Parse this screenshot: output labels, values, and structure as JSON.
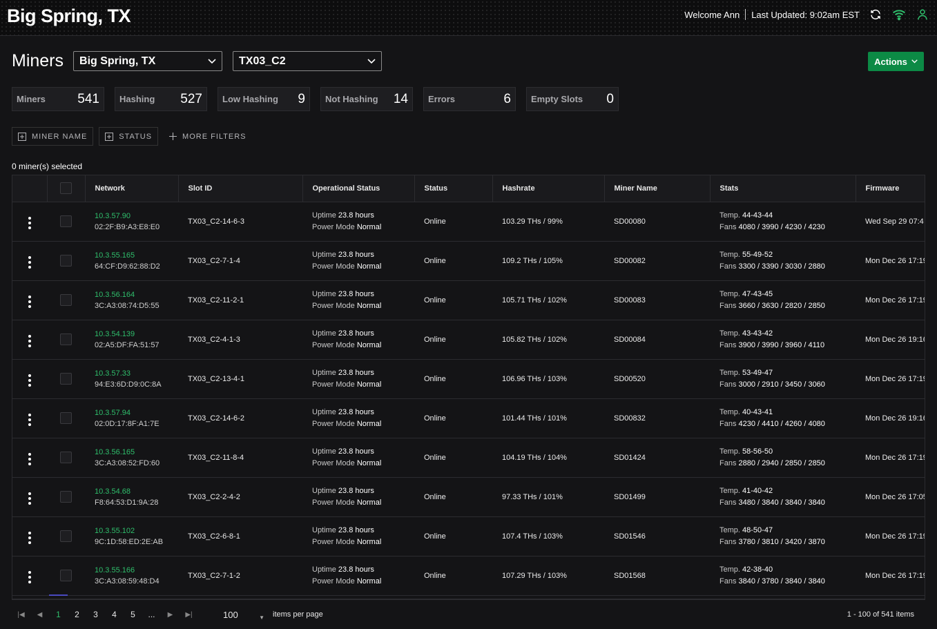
{
  "site_title": "Big Spring, TX",
  "topbar": {
    "welcome": "Welcome Ann",
    "last_updated": "Last Updated: 9:02am EST"
  },
  "page_title": "Miners",
  "site_select": "Big Spring, TX",
  "container_select": "TX03_C2",
  "actions_label": "Actions",
  "stats": [
    {
      "label": "Miners",
      "value": "541"
    },
    {
      "label": "Hashing",
      "value": "527"
    },
    {
      "label": "Low Hashing",
      "value": "9"
    },
    {
      "label": "Not Hashing",
      "value": "14"
    },
    {
      "label": "Errors",
      "value": "6"
    },
    {
      "label": "Empty Slots",
      "value": "0"
    }
  ],
  "filters": {
    "miner_name": "MINER NAME",
    "status": "STATUS",
    "more": "MORE FILTERS"
  },
  "selected_count": "0 miner(s) selected",
  "columns": [
    "Network",
    "Slot ID",
    "Operational Status",
    "Status",
    "Hashrate",
    "Miner Name",
    "Stats",
    "Firmware"
  ],
  "labels": {
    "uptime": "Uptime",
    "power_mode": "Power Mode",
    "temp": "Temp.",
    "fans": "Fans"
  },
  "rows": [
    {
      "ip": "10.3.57.90",
      "mac": "02:2F:B9:A3:E8:E0",
      "slot": "TX03_C2-14-6-3",
      "uptime": "23.8 hours",
      "power": "Normal",
      "status": "Online",
      "hashrate": "103.29 THs / 99%",
      "name": "SD00080",
      "temp": "44-43-44",
      "fans": "4080 / 3990 / 4230 / 4230",
      "firmware": "Wed Sep 29 07:4"
    },
    {
      "ip": "10.3.55.165",
      "mac": "64:CF:D9:62:88:D2",
      "slot": "TX03_C2-7-1-4",
      "uptime": "23.8 hours",
      "power": "Normal",
      "status": "Online",
      "hashrate": "109.2 THs / 105%",
      "name": "SD00082",
      "temp": "55-49-52",
      "fans": "3300 / 3390 / 3030 / 2880",
      "firmware": "Mon Dec 26 17:19"
    },
    {
      "ip": "10.3.56.164",
      "mac": "3C:A3:08:74:D5:55",
      "slot": "TX03_C2-11-2-1",
      "uptime": "23.8 hours",
      "power": "Normal",
      "status": "Online",
      "hashrate": "105.71 THs / 102%",
      "name": "SD00083",
      "temp": "47-43-45",
      "fans": "3660 / 3630 / 2820 / 2850",
      "firmware": "Mon Dec 26 17:19"
    },
    {
      "ip": "10.3.54.139",
      "mac": "02:A5:DF:FA:51:57",
      "slot": "TX03_C2-4-1-3",
      "uptime": "23.8 hours",
      "power": "Normal",
      "status": "Online",
      "hashrate": "105.82 THs / 102%",
      "name": "SD00084",
      "temp": "43-43-42",
      "fans": "3900 / 3990 / 3960 / 4110",
      "firmware": "Mon Dec 26 19:16"
    },
    {
      "ip": "10.3.57.33",
      "mac": "94:E3:6D:D9:0C:8A",
      "slot": "TX03_C2-13-4-1",
      "uptime": "23.8 hours",
      "power": "Normal",
      "status": "Online",
      "hashrate": "106.96 THs / 103%",
      "name": "SD00520",
      "temp": "53-49-47",
      "fans": "3000 / 2910 / 3450 / 3060",
      "firmware": "Mon Dec 26 17:19"
    },
    {
      "ip": "10.3.57.94",
      "mac": "02:0D:17:8F:A1:7E",
      "slot": "TX03_C2-14-6-2",
      "uptime": "23.8 hours",
      "power": "Normal",
      "status": "Online",
      "hashrate": "101.44 THs / 101%",
      "name": "SD00832",
      "temp": "40-43-41",
      "fans": "4230 / 4410 / 4260 / 4080",
      "firmware": "Mon Dec 26 19:16"
    },
    {
      "ip": "10.3.56.165",
      "mac": "3C:A3:08:52:FD:60",
      "slot": "TX03_C2-11-8-4",
      "uptime": "23.8 hours",
      "power": "Normal",
      "status": "Online",
      "hashrate": "104.19 THs / 104%",
      "name": "SD01424",
      "temp": "58-56-50",
      "fans": "2880 / 2940 / 2850 / 2850",
      "firmware": "Mon Dec 26 17:19"
    },
    {
      "ip": "10.3.54.68",
      "mac": "F8:64:53:D1:9A:28",
      "slot": "TX03_C2-2-4-2",
      "uptime": "23.8 hours",
      "power": "Normal",
      "status": "Online",
      "hashrate": "97.33 THs / 101%",
      "name": "SD01499",
      "temp": "41-40-42",
      "fans": "3480 / 3840 / 3840 / 3840",
      "firmware": "Mon Dec 26 17:05"
    },
    {
      "ip": "10.3.55.102",
      "mac": "9C:1D:58:ED:2E:AB",
      "slot": "TX03_C2-6-8-1",
      "uptime": "23.8 hours",
      "power": "Normal",
      "status": "Online",
      "hashrate": "107.4 THs / 103%",
      "name": "SD01546",
      "temp": "48-50-47",
      "fans": "3780 / 3810 / 3420 / 3870",
      "firmware": "Mon Dec 26 17:19"
    },
    {
      "ip": "10.3.55.166",
      "mac": "3C:A3:08:59:48:D4",
      "slot": "TX03_C2-7-1-2",
      "uptime": "23.8 hours",
      "power": "Normal",
      "status": "Online",
      "hashrate": "107.29 THs / 103%",
      "name": "SD01568",
      "temp": "42-38-40",
      "fans": "3840 / 3780 / 3840 / 3840",
      "firmware": "Mon Dec 26 17:19"
    }
  ],
  "pager": {
    "pages": [
      "1",
      "2",
      "3",
      "4",
      "5",
      "..."
    ],
    "per_page": "100",
    "per_page_label": "items per page",
    "range": "1 - 100 of 541 items"
  }
}
